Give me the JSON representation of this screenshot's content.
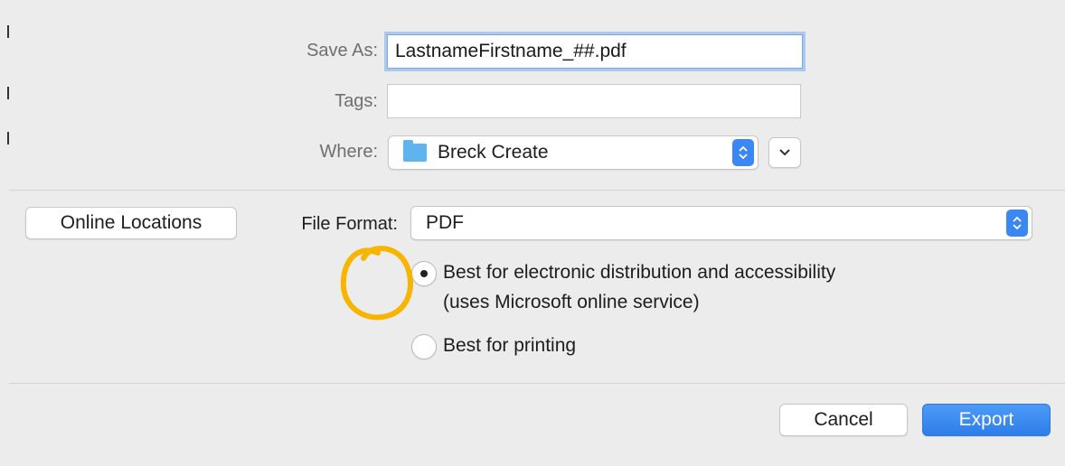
{
  "save_as": {
    "label": "Save As:",
    "value": "LastnameFirstname_##.pdf"
  },
  "tags": {
    "label": "Tags:",
    "value": ""
  },
  "where": {
    "label": "Where:",
    "value": "Breck Create"
  },
  "online_locations": {
    "label": "Online Locations"
  },
  "file_format": {
    "label": "File Format:",
    "value": "PDF"
  },
  "options": [
    {
      "line1": "Best for electronic distribution and accessibility",
      "line2": "(uses Microsoft online service)",
      "selected": true
    },
    {
      "line1": "Best for printing",
      "selected": false
    }
  ],
  "buttons": {
    "cancel": "Cancel",
    "export": "Export"
  },
  "colors": {
    "accent": "#3b87f3",
    "annotation": "#f7b500",
    "background": "#ececec"
  },
  "icons": {
    "folder": "folder-icon",
    "stepper": "up-down-chevron-icon",
    "expand": "chevron-down-icon"
  }
}
